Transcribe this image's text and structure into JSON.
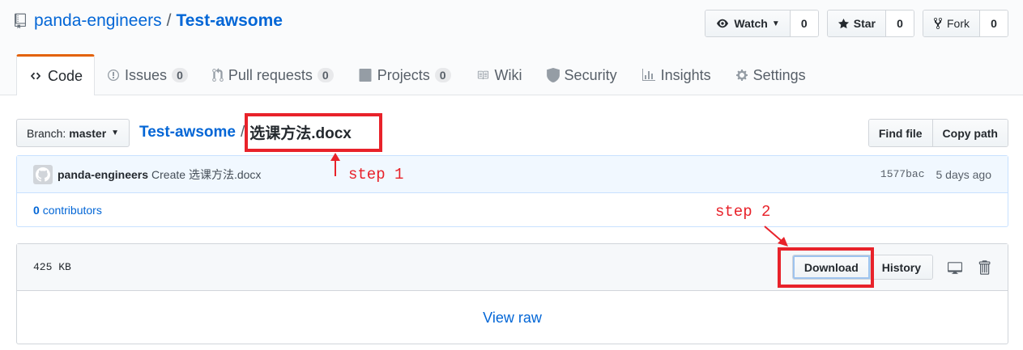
{
  "repo": {
    "owner": "panda-engineers",
    "separator": "/",
    "name": "Test-awsome"
  },
  "actions": {
    "watch_label": "Watch",
    "watch_count": "0",
    "star_label": "Star",
    "star_count": "0",
    "fork_label": "Fork",
    "fork_count": "0"
  },
  "tabs": [
    {
      "label": "Code",
      "icon": "code-icon"
    },
    {
      "label": "Issues",
      "count": "0",
      "icon": "issue-icon"
    },
    {
      "label": "Pull requests",
      "count": "0",
      "icon": "pull-request-icon"
    },
    {
      "label": "Projects",
      "count": "0",
      "icon": "project-icon"
    },
    {
      "label": "Wiki",
      "icon": "book-icon"
    },
    {
      "label": "Security",
      "icon": "shield-icon"
    },
    {
      "label": "Insights",
      "icon": "graph-icon"
    },
    {
      "label": "Settings",
      "icon": "gear-icon"
    }
  ],
  "file_nav": {
    "branch_prefix": "Branch:",
    "branch_name": "master",
    "breadcrumb_root": "Test-awsome",
    "breadcrumb_sep": "/",
    "file_name": "选课方法.docx",
    "find_file": "Find file",
    "copy_path": "Copy path"
  },
  "commit": {
    "author": "panda-engineers",
    "message": "Create 选课方法.docx",
    "sha": "1577bac",
    "time_ago": "5 days ago",
    "contributors_count": "0",
    "contributors_label": "contributors"
  },
  "file": {
    "size": "425 KB",
    "download": "Download",
    "history": "History",
    "view_raw": "View raw"
  },
  "annotations": {
    "step1": "step 1",
    "step2": "step 2",
    "color": "#e8222a"
  },
  "colors": {
    "link": "#0366d6",
    "tab_accent": "#e36209"
  }
}
